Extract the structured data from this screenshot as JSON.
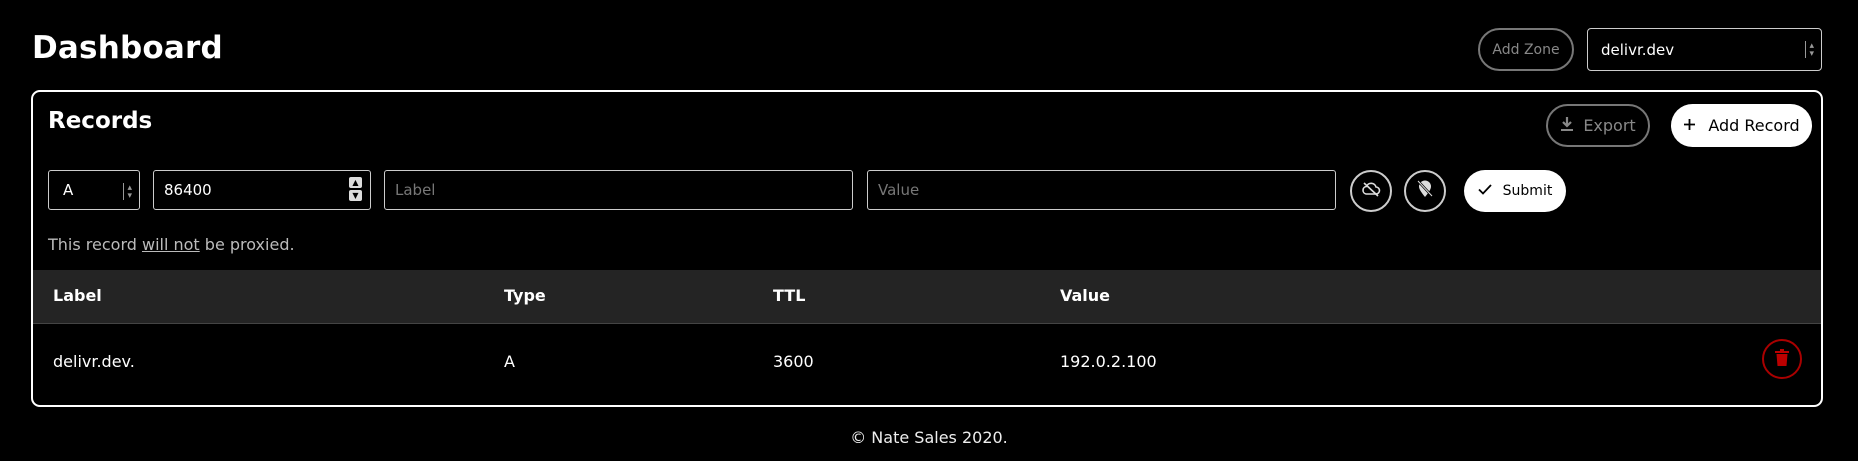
{
  "header": {
    "title": "Dashboard",
    "add_zone_label": "Add Zone",
    "zone_selected": "delivr.dev"
  },
  "records": {
    "title": "Records",
    "export_label": "Export",
    "add_record_label": "Add Record",
    "form": {
      "type_value": "A",
      "ttl_value": "86400",
      "label_placeholder": "Label",
      "value_placeholder": "Value",
      "submit_label": "Submit"
    },
    "proxy_note": {
      "prefix": "This record ",
      "emphasis": "will not",
      "suffix": " be proxied."
    },
    "columns": [
      "Label",
      "Type",
      "TTL",
      "Value"
    ],
    "rows": [
      {
        "label": "delivr.dev.",
        "type": "A",
        "ttl": "3600",
        "value": "192.0.2.100"
      }
    ]
  },
  "icons": {
    "export": "download-icon",
    "add": "plus-icon",
    "cloud": "cloud-off-icon",
    "pin": "location-off-icon",
    "submit": "check-icon",
    "delete": "trash-icon"
  },
  "colors": {
    "background": "#000000",
    "danger": "#aa0000",
    "header_row": "#242424"
  },
  "footer": {
    "text": "© Nate Sales 2020."
  }
}
